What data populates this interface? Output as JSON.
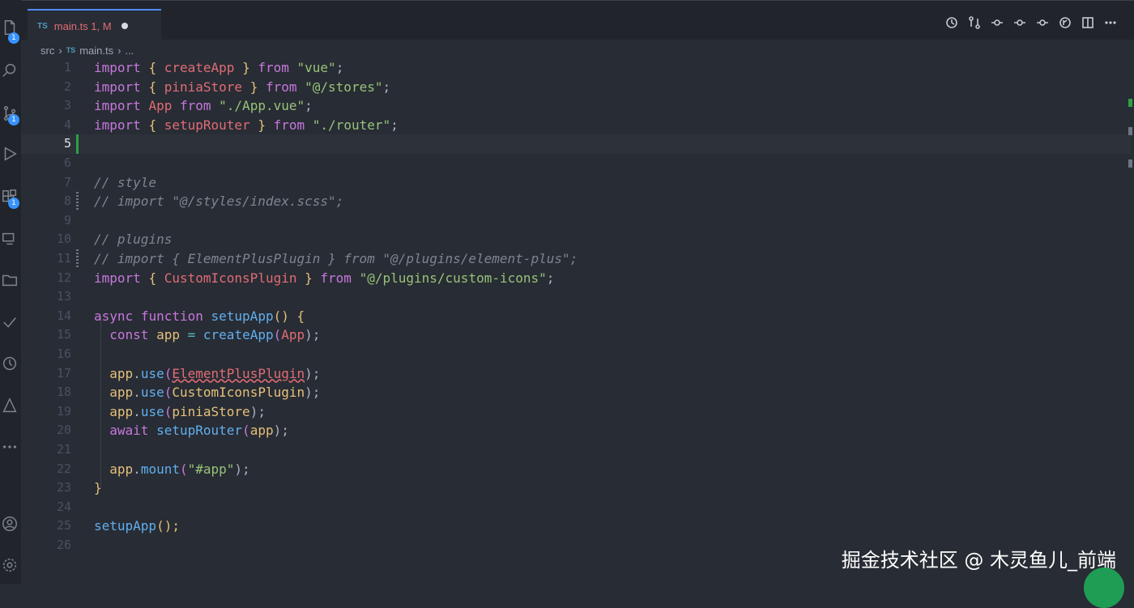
{
  "tab": {
    "lang": "TS",
    "label": "main.ts 1, M"
  },
  "breadcrumb": {
    "folder": "src",
    "lang": "TS",
    "file": "main.ts",
    "more": "..."
  },
  "badges": {
    "explorer": "1",
    "scm": "1",
    "extensions": "1"
  },
  "editor": {
    "line_numbers": [
      "1",
      "2",
      "3",
      "4",
      "5",
      "6",
      "7",
      "8",
      "9",
      "10",
      "11",
      "12",
      "13",
      "14",
      "15",
      "16",
      "17",
      "18",
      "19",
      "20",
      "21",
      "22",
      "23",
      "24",
      "25",
      "26"
    ],
    "active_line": "5"
  },
  "code": {
    "l1": [
      "import",
      "{",
      "createApp",
      "}",
      "from",
      "\"vue\"",
      ";"
    ],
    "l2": [
      "import",
      "{",
      "piniaStore",
      "}",
      "from",
      "\"@/stores\"",
      ";"
    ],
    "l3": [
      "import",
      "App",
      "from",
      "\"./App.vue\"",
      ";"
    ],
    "l4": [
      "import",
      "{",
      "setupRouter",
      "}",
      "from",
      "\"./router\"",
      ";"
    ],
    "l7": "// style",
    "l8": "// import \"@/styles/index.scss\";",
    "l10": "// plugins",
    "l11": "// import { ElementPlusPlugin } from \"@/plugins/element-plus\";",
    "l12": [
      "import",
      "{",
      "CustomIconsPlugin",
      "}",
      "from",
      "\"@/plugins/custom-icons\"",
      ";"
    ],
    "l14": [
      "async",
      "function",
      "setupApp",
      "()",
      "{"
    ],
    "l15": [
      "const",
      "app",
      "=",
      "createApp",
      "(",
      "App",
      ");"
    ],
    "l17": [
      "app",
      ".",
      "use",
      "(",
      "ElementPlusPlugin",
      ");"
    ],
    "l18": [
      "app",
      ".",
      "use",
      "(",
      "CustomIconsPlugin",
      ");"
    ],
    "l19": [
      "app",
      ".",
      "use",
      "(",
      "piniaStore",
      ");"
    ],
    "l20": [
      "await",
      "setupRouter",
      "(",
      "app",
      ");"
    ],
    "l22": [
      "app",
      ".",
      "mount",
      "(",
      "\"#app\"",
      ");"
    ],
    "l23": "}",
    "l25": [
      "setupApp",
      "();"
    ]
  },
  "watermark": "掘金技术社区 @ 木灵鱼儿_前端",
  "colors": {
    "keyword": "#c678dd",
    "string": "#98c379",
    "function": "#61afef",
    "variable": "#e06c75",
    "bracket": "#e5c07b",
    "comment": "#7f848e",
    "background": "#282c34"
  }
}
